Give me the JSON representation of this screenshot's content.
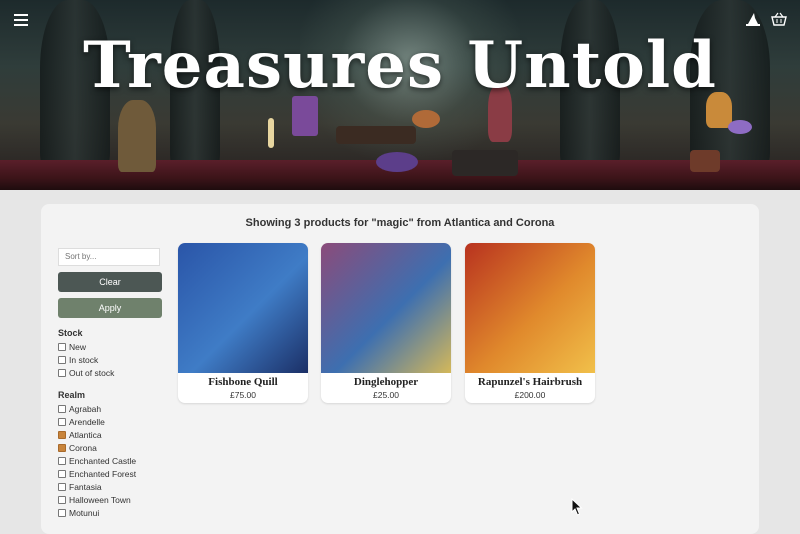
{
  "site": {
    "title": "Treasures Untold"
  },
  "header": {
    "icons": [
      "menu-icon",
      "wizard-hat-icon",
      "basket-icon"
    ]
  },
  "results": {
    "heading": "Showing 3 products for \"magic\" from Atlantica and Corona"
  },
  "filters": {
    "sort_placeholder": "Sort by...",
    "clear_label": "Clear",
    "apply_label": "Apply",
    "stock_title": "Stock",
    "stock": [
      {
        "label": "New",
        "checked": false
      },
      {
        "label": "In stock",
        "checked": false
      },
      {
        "label": "Out of stock",
        "checked": false
      }
    ],
    "realm_title": "Realm",
    "realm": [
      {
        "label": "Agrabah",
        "checked": false
      },
      {
        "label": "Arendelle",
        "checked": false
      },
      {
        "label": "Atlantica",
        "checked": true
      },
      {
        "label": "Corona",
        "checked": true
      },
      {
        "label": "Enchanted Castle",
        "checked": false
      },
      {
        "label": "Enchanted Forest",
        "checked": false
      },
      {
        "label": "Fantasia",
        "checked": false
      },
      {
        "label": "Halloween Town",
        "checked": false
      },
      {
        "label": "Motunui",
        "checked": false
      }
    ]
  },
  "products": [
    {
      "name": "Fishbone Quill",
      "price": "£75.00",
      "colors": [
        "#2a55a8",
        "#3f7cc6",
        "#1b2f66"
      ]
    },
    {
      "name": "Dinglehopper",
      "price": "£25.00",
      "colors": [
        "#8b4b7a",
        "#3d6fb0",
        "#d4b85a"
      ]
    },
    {
      "name": "Rapunzel's Hairbrush",
      "price": "£200.00",
      "colors": [
        "#b8321f",
        "#e0892c",
        "#f1c04a"
      ]
    }
  ]
}
